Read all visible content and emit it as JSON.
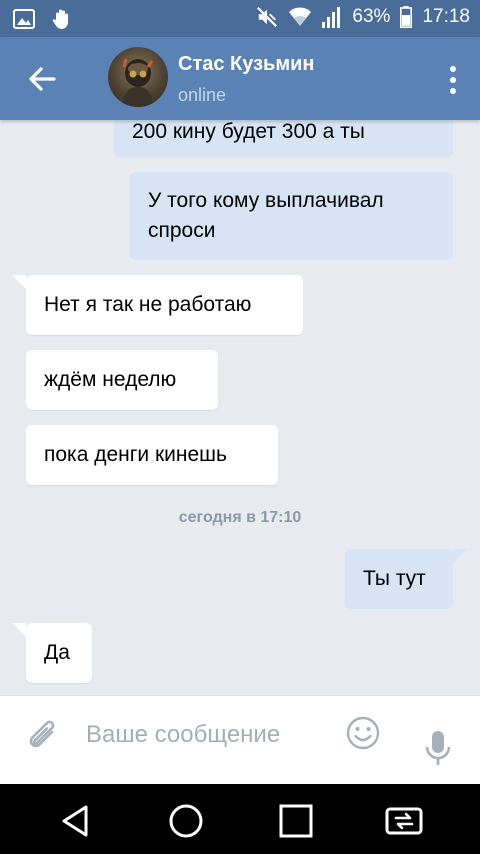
{
  "status_bar": {
    "battery": "63%",
    "time": "17:18",
    "icons": [
      "gallery-icon",
      "hand-icon",
      "mute-icon",
      "wifi-icon",
      "signal-icon",
      "battery-icon"
    ]
  },
  "header": {
    "contact_name": "Стас Кузьмин",
    "presence": "online",
    "icons": [
      "back-arrow-icon",
      "more-vert-icon"
    ]
  },
  "messages": [
    {
      "direction": "out",
      "text": "200 кину будет 300 а ты"
    },
    {
      "direction": "out",
      "lines": [
        "У того кому выплачивал",
        "спроси"
      ]
    },
    {
      "direction": "in",
      "text": "Нет я так не работаю"
    },
    {
      "direction": "in",
      "text": "ждём неделю"
    },
    {
      "direction": "in",
      "text": "пока денги кинешь"
    },
    {
      "direction": "out",
      "text": "Ты тут"
    },
    {
      "direction": "in",
      "text": "Да"
    }
  ],
  "timestamp": "сегодня в 17:10",
  "input": {
    "placeholder": "Ваше сообщение",
    "value": "",
    "icons": [
      "attach-icon",
      "emoji-icon",
      "mic-icon"
    ]
  },
  "nav": {
    "icons": [
      "back-nav-icon",
      "home-nav-icon",
      "recents-nav-icon",
      "switch-nav-icon"
    ]
  },
  "colors": {
    "status_bar": "#4a6c98",
    "app_bar": "#5b82b4",
    "chat_background": "#e7ebf0",
    "outgoing_bubble": "#d6e4f6",
    "incoming_bubble": "#ffffff"
  }
}
